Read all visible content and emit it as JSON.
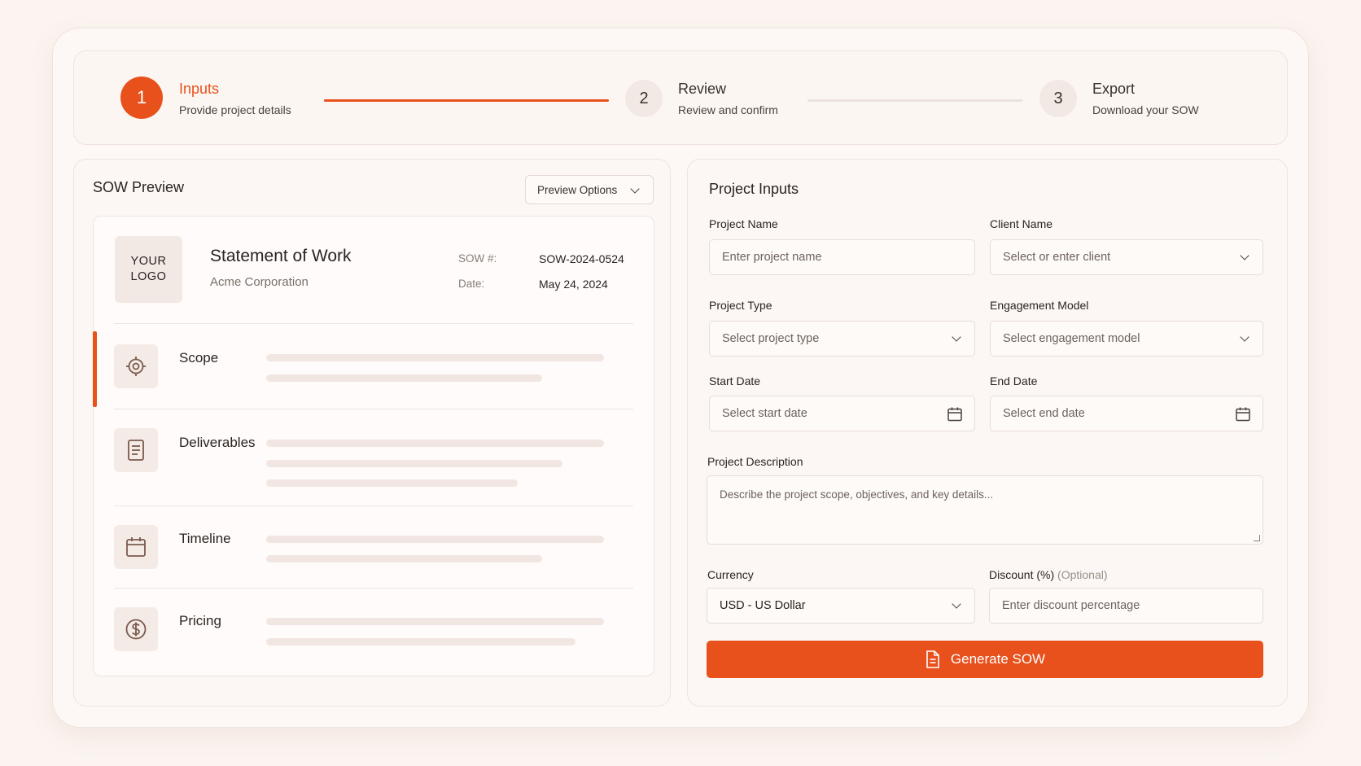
{
  "stepper": {
    "steps": [
      {
        "number": "1",
        "title": "Inputs",
        "subtitle": "Provide project details"
      },
      {
        "number": "2",
        "title": "Review",
        "subtitle": "Review and confirm"
      },
      {
        "number": "3",
        "title": "Export",
        "subtitle": "Download your SOW"
      }
    ],
    "active_step": 1
  },
  "preview": {
    "title": "SOW Preview",
    "options_label": "Preview Options",
    "logo_line1": "YOUR",
    "logo_line2": "LOGO",
    "doc_title": "Statement of Work",
    "client": "Acme Corporation",
    "sow_label": "SOW #:",
    "sow_value": "SOW-2024-0524",
    "date_label": "Date:",
    "date_value": "May 24, 2024",
    "sections": [
      {
        "label": "Scope",
        "icon": "target-icon"
      },
      {
        "label": "Deliverables",
        "icon": "document-icon"
      },
      {
        "label": "Timeline",
        "icon": "calendar-icon"
      },
      {
        "label": "Pricing",
        "icon": "dollar-icon"
      }
    ]
  },
  "form": {
    "title": "Project Inputs",
    "project_name": {
      "label": "Project Name",
      "placeholder": "Enter project name"
    },
    "client_name": {
      "label": "Client Name",
      "placeholder": "Select or enter client"
    },
    "project_type": {
      "label": "Project Type",
      "placeholder": "Select project type"
    },
    "engagement_model": {
      "label": "Engagement Model",
      "placeholder": "Select engagement model"
    },
    "start_date": {
      "label": "Start Date",
      "placeholder": "Select start date"
    },
    "end_date": {
      "label": "End Date",
      "placeholder": "Select end date"
    },
    "description": {
      "label": "Project Description",
      "placeholder": "Describe the project scope, objectives, and key details..."
    },
    "currency": {
      "label": "Currency",
      "value": "USD - US Dollar"
    },
    "discount": {
      "label": "Discount (%)",
      "optional": "(Optional)",
      "placeholder": "Enter discount percentage"
    },
    "generate_label": "Generate SOW"
  },
  "colors": {
    "accent": "#e8501c",
    "background": "#fbf4f0"
  }
}
